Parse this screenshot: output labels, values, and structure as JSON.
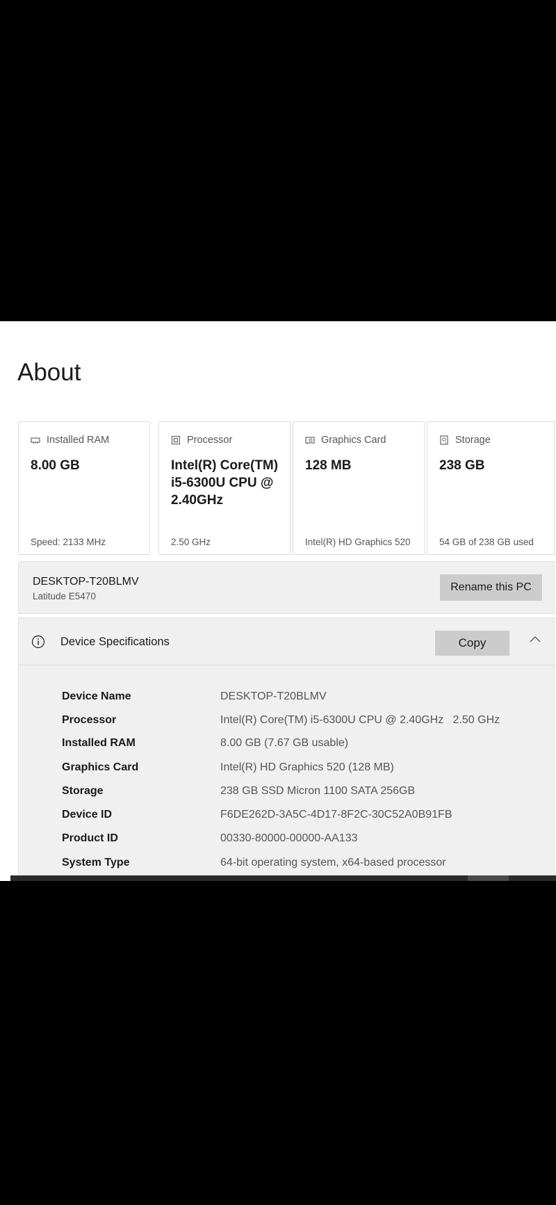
{
  "page": {
    "title": "About"
  },
  "cards": [
    {
      "label": "Installed RAM",
      "icon": "ram-icon",
      "value": "8.00 GB",
      "sub": "Speed: 2133 MHz"
    },
    {
      "label": "Processor",
      "icon": "processor-icon",
      "value": "Intel(R) Core(TM) i5-6300U CPU @ 2.40GHz",
      "sub": "2.50 GHz"
    },
    {
      "label": "Graphics Card",
      "icon": "graphics-card-icon",
      "value": "128 MB",
      "sub": "Intel(R) HD Graphics 520"
    },
    {
      "label": "Storage",
      "icon": "storage-icon",
      "value": "238 GB",
      "sub": "54 GB of 238 GB used"
    }
  ],
  "pc": {
    "name": "DESKTOP-T20BLMV",
    "model": "Latitude E5470",
    "rename_label": "Rename this PC"
  },
  "specs": {
    "title": "Device Specifications",
    "copy_label": "Copy",
    "rows": [
      {
        "key": "Device Name",
        "value": "DESKTOP-T20BLMV"
      },
      {
        "key": "Processor",
        "value": "Intel(R) Core(TM) i5-6300U CPU @ 2.40GHz   2.50 GHz"
      },
      {
        "key": "Installed RAM",
        "value": "8.00 GB (7.67 GB usable)"
      },
      {
        "key": "Graphics Card",
        "value": "Intel(R) HD Graphics 520 (128 MB)"
      },
      {
        "key": "Storage",
        "value": "238 GB SSD Micron 1100 SATA 256GB"
      },
      {
        "key": "Device ID",
        "value": "F6DE262D-3A5C-4D17-8F2C-30C52A0B91FB"
      },
      {
        "key": "Product ID",
        "value": "00330-80000-00000-AA133"
      },
      {
        "key": "System Type",
        "value": "64-bit operating system, x64-based processor"
      }
    ]
  },
  "colors": {
    "background": "#000000",
    "panel": "#f0f0f0",
    "button": "#cccccc"
  }
}
